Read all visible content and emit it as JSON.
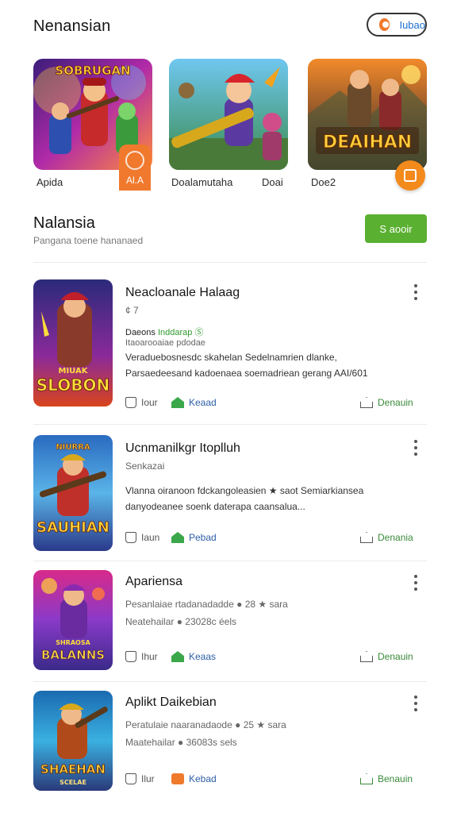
{
  "header": {
    "title": "Nenansian",
    "pill_label": "Iubao"
  },
  "featured": [
    {
      "caption": "Apida",
      "badge_label": "Al.A",
      "art_title": "SOBRUGAN",
      "icon": "game-art-icon"
    },
    {
      "caption": "Doalamutaha",
      "caption2": "Doai",
      "art_title": "",
      "icon": "game-art-icon"
    },
    {
      "caption": "Doe2",
      "art_title": "DEAIHAN",
      "icon": "game-art-icon"
    }
  ],
  "section": {
    "title": "Nalansia",
    "subtitle": "Pangana toene hananaed",
    "button_label": "S aooir"
  },
  "apps": [
    {
      "title": "Neacloanale Halaag",
      "meta": "¢ 7",
      "tag": "Daeons",
      "tag_green": "Inddarap Ⓢ",
      "desc_small": "Itaoarooaiae pdodae",
      "desc": "Veraduebosnesdc skahelan Sedelnamrien dlanke, Parsaedeesand kadoenaea soemadriean gerang AAI/601",
      "like_label": "Iour",
      "share_label": "Keaad",
      "install_label": "Denauin",
      "art_title": "SLOBON",
      "art_sub": "MIUAK"
    },
    {
      "title": "Ucnmanilkgr Itoplluh",
      "meta": "Senkazai",
      "desc": "Vlanna oiranoon fdckangoleasien ★ saot Semiarkiansea danyodeanee soenk daterapa caansalua...",
      "like_label": "Iaun",
      "share_label": "Pebad",
      "install_label": "Denania",
      "art_title": "SAUHIAN",
      "art_sub": "NIURRA"
    },
    {
      "title": "Apariensa",
      "meta": "Pesanlaiae rtadanadadde ● 28 ★ sara",
      "desc": "Neatehailar ● 23028c éels",
      "like_label": "Ihur",
      "share_label": "Keaas",
      "install_label": "Denauin",
      "art_title": "BALANNS",
      "art_sub": "SHRAOSA"
    },
    {
      "title": "Aplikt Daikebian",
      "meta": "Peratulaie naaranadaode ● 25 ★ sara",
      "desc": "Maatehailar ● 36083s sels",
      "like_label": "Ilur",
      "share_label": "Kebad",
      "install_label": "Benauin",
      "art_title": "SHAEHAN",
      "art_sub": "SCELAE"
    }
  ],
  "colors": {
    "accent_green": "#5ab030",
    "accent_orange": "#f0792d",
    "link_blue": "#2c5ea8"
  }
}
